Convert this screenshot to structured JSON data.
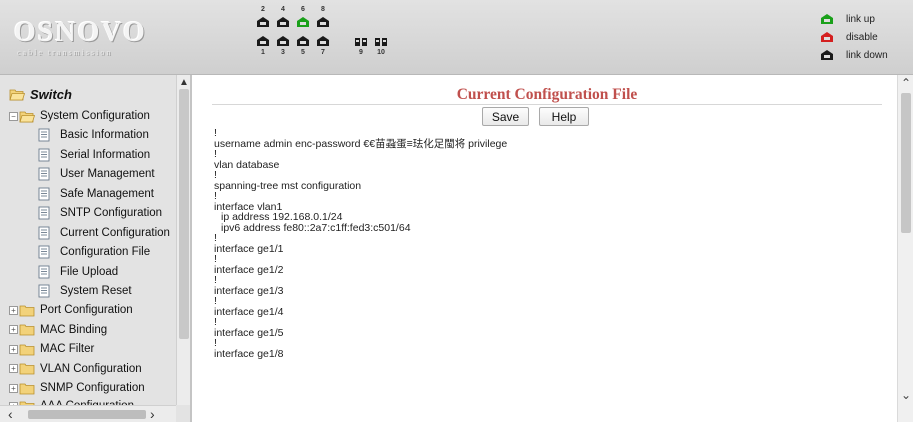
{
  "header": {
    "logo_text": "OSNOVO",
    "logo_subtitle": "cable transmission",
    "port_numbers_top": [
      "2",
      "4",
      "6",
      "8"
    ],
    "port_numbers_bottom": [
      "1",
      "3",
      "5",
      "7",
      "9",
      "10"
    ],
    "legend": [
      {
        "label": "link up",
        "color": "#1aa01a"
      },
      {
        "label": "disable",
        "color": "#d42020"
      },
      {
        "label": "link down",
        "color": "#1a1a1a"
      }
    ],
    "colors": {
      "link_up": "#1aa01a",
      "disable": "#d42020",
      "link_down": "#1a1a1a"
    }
  },
  "sidebar": {
    "root_label": "Switch",
    "system_config_label": "System Configuration",
    "system_items": [
      "Basic Information",
      "Serial Information",
      "User Management",
      "Safe Management",
      "SNTP Configuration",
      "Current Configuration",
      "Configuration File",
      "File Upload",
      "System Reset"
    ],
    "folders": [
      "Port Configuration",
      "MAC Binding",
      "MAC Filter",
      "VLAN Configuration",
      "SNMP Configuration",
      "AAA Configuration"
    ]
  },
  "main": {
    "title": "Current Configuration File",
    "title_color": "#c0504d",
    "buttons": {
      "save": "Save",
      "help": "Help"
    },
    "config_lines": [
      "!",
      "username admin enc-password €€苗蝨蛋≡珐化足閩将 privilege",
      "!",
      "vlan database",
      "!",
      "spanning-tree mst configuration",
      "!",
      "interface vlan1",
      "ip address 192.168.0.1/24",
      "ipv6 address fe80::2a7:c1ff:fed3:c501/64",
      "!",
      "interface ge1/1",
      "!",
      "interface ge1/2",
      "!",
      "interface ge1/3",
      "!",
      "interface ge1/4",
      "!",
      "interface ge1/5",
      "!",
      "interface ge1/8"
    ]
  }
}
